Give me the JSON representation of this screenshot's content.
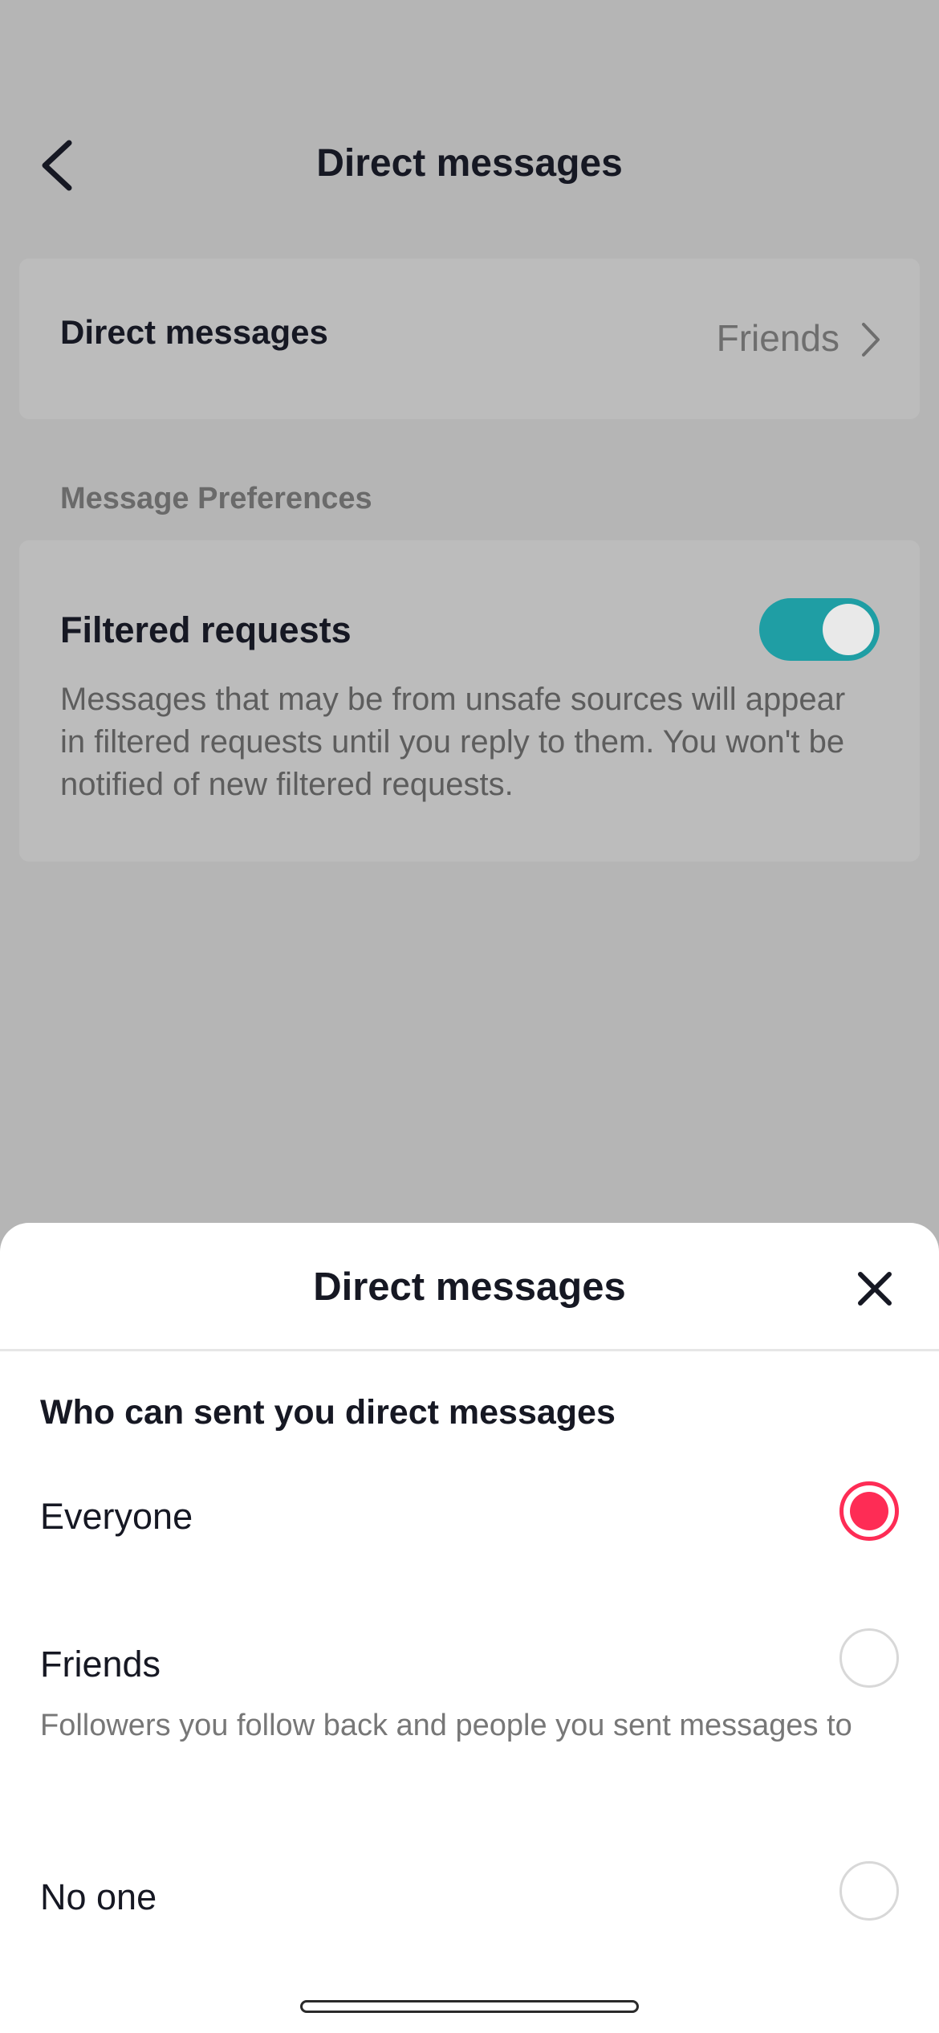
{
  "background_page": {
    "nav": {
      "title": "Direct messages",
      "back_icon": "chevron-left-icon"
    },
    "direct_messages_row": {
      "label": "Direct messages",
      "value": "Friends",
      "chevron_icon": "chevron-right-icon"
    },
    "section_label": "Message Preferences",
    "filtered_requests": {
      "title": "Filtered requests",
      "toggle_on": true,
      "description": "Messages that may be from unsafe sources will appear in filtered requests until you reply to them. You won't be notified of new filtered requests."
    }
  },
  "sheet": {
    "title": "Direct messages",
    "close_icon": "close-icon",
    "question": "Who can sent you direct messages",
    "options": [
      {
        "label": "Everyone",
        "selected": true
      },
      {
        "label": "Friends",
        "description": "Followers you follow back and people you sent messages to",
        "selected": false
      },
      {
        "label": "No one",
        "selected": false
      }
    ]
  },
  "colors": {
    "accent": "#fe2c55",
    "toggle_on": "#1f9ea4",
    "overlay_bg": "#b5b5b5"
  }
}
